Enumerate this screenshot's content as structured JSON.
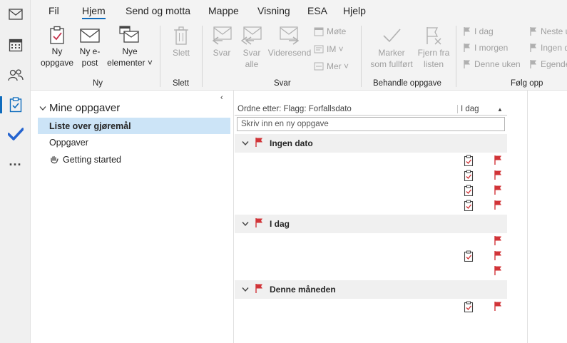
{
  "appbar": {
    "items": [
      {
        "icon": "mail-icon"
      },
      {
        "icon": "calendar-icon"
      },
      {
        "icon": "people-icon"
      },
      {
        "icon": "tasks-icon"
      },
      {
        "icon": "todo-check-icon"
      },
      {
        "icon": "more-icon"
      }
    ],
    "more_label": "..."
  },
  "tabs": [
    "Fil",
    "Hjem",
    "Send og motta",
    "Mappe",
    "Visning",
    "ESA",
    "Hjelp"
  ],
  "ribbon": {
    "new": {
      "new_task": [
        "Ny",
        "oppgave"
      ],
      "new_email": [
        "Ny e-",
        "post"
      ],
      "new_items": [
        "Nye",
        "elementer ˅"
      ],
      "group": "Ny"
    },
    "delete": {
      "label": "Slett",
      "group": "Slett"
    },
    "respond": {
      "reply": [
        "Svar"
      ],
      "reply_all": [
        "Svar",
        "alle"
      ],
      "forward": [
        "Videresend"
      ],
      "meeting": "Møte",
      "im": "IM ˅",
      "more": "Mer ˅",
      "group": "Svar"
    },
    "manage": {
      "mark_complete": [
        "Marker",
        "som fullført"
      ],
      "remove_from_list": [
        "Fjern fra",
        "listen"
      ],
      "group": "Behandle oppgave"
    },
    "followup": {
      "today": "I dag",
      "tomorrow": "I morgen",
      "this_week": "Denne uken",
      "next_week": "Neste u",
      "no_date": "Ingen d",
      "custom": "Egendef",
      "group": "Følg opp"
    }
  },
  "folders": {
    "header": "Mine oppgaver",
    "items": [
      "Liste over gjøremål",
      "Oppgaver",
      "Getting started"
    ],
    "collapse": "‹"
  },
  "tasklist": {
    "sort_by": "Ordne etter: Flagg: Forfallsdato",
    "sort_col": "I dag",
    "sort_arrow": "▲",
    "new_task_placeholder": "Skriv inn en ny oppgave",
    "groups": [
      {
        "label": "Ingen dato",
        "rows": [
          {
            "title": "",
            "clip": true
          },
          {
            "title": "",
            "clip": true
          },
          {
            "title": "",
            "clip": true
          },
          {
            "title": "",
            "clip": true
          }
        ]
      },
      {
        "label": "I dag",
        "rows": [
          {
            "title": "",
            "clip": false
          },
          {
            "title": "",
            "clip": true
          },
          {
            "title": "",
            "clip": false
          }
        ]
      },
      {
        "label": "Denne måneden",
        "rows": [
          {
            "title": "",
            "clip": true
          }
        ]
      }
    ]
  },
  "colors": {
    "accent": "#0f6cbd",
    "flag_red": "#d13438",
    "selected_bg": "#cce4f7"
  }
}
